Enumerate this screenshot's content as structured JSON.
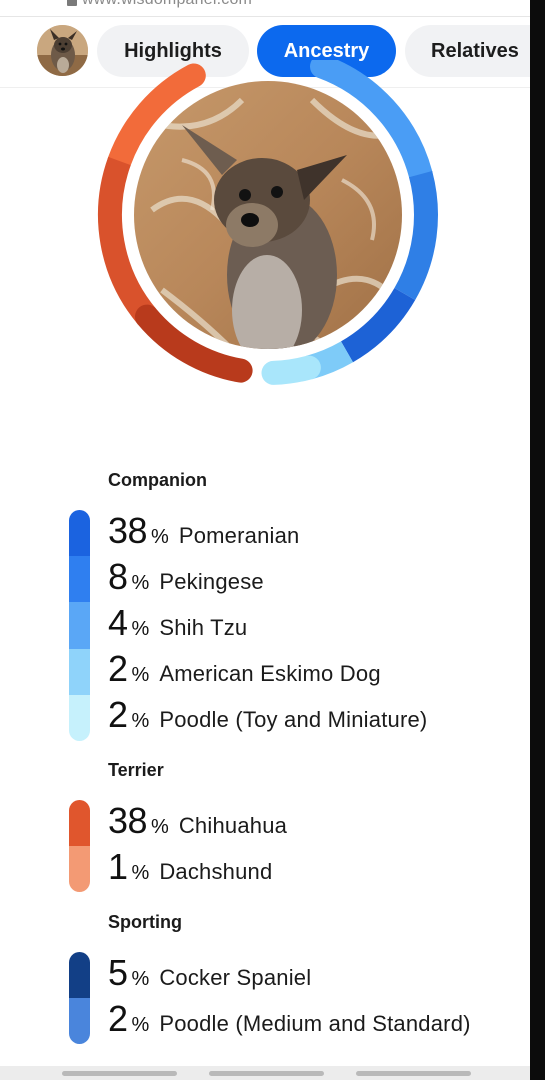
{
  "browser": {
    "url": "www.wisdompanel.com"
  },
  "tabs": {
    "avatar_icon": "dog-photo-icon",
    "items": [
      {
        "label": "Highlights",
        "active": false
      },
      {
        "label": "Ancestry",
        "active": true
      },
      {
        "label": "Relatives",
        "active": false
      }
    ]
  },
  "ring": {
    "photo": "dog-photo",
    "left_colors": [
      "#f26b3a",
      "#d9522c",
      "#b83a1c"
    ],
    "right_colors": [
      "#4a9df5",
      "#2f7fe6",
      "#1d62d6",
      "#7ecbf8",
      "#a9e6fb"
    ]
  },
  "groups": [
    {
      "title": "Companion",
      "colors": [
        "#1b63e0",
        "#2f7ff0",
        "#5aa7f6",
        "#8fd3fa",
        "#c6f1fc"
      ],
      "breeds": [
        {
          "pct": "38",
          "name": "Pomeranian"
        },
        {
          "pct": "8",
          "name": "Pekingese"
        },
        {
          "pct": "4",
          "name": "Shih Tzu"
        },
        {
          "pct": "2",
          "name": "American Eskimo Dog"
        },
        {
          "pct": "2",
          "name": "Poodle (Toy and Miniature)"
        }
      ]
    },
    {
      "title": "Terrier",
      "colors": [
        "#e0562d",
        "#f39a74"
      ],
      "breeds": [
        {
          "pct": "38",
          "name": "Chihuahua"
        },
        {
          "pct": "1",
          "name": "Dachshund"
        }
      ]
    },
    {
      "title": "Sporting",
      "colors": [
        "#123f86",
        "#4a85dc"
      ],
      "breeds": [
        {
          "pct": "5",
          "name": "Cocker Spaniel"
        },
        {
          "pct": "2",
          "name": "Poodle (Medium and Standard)"
        }
      ]
    }
  ],
  "pct_symbol": "%"
}
